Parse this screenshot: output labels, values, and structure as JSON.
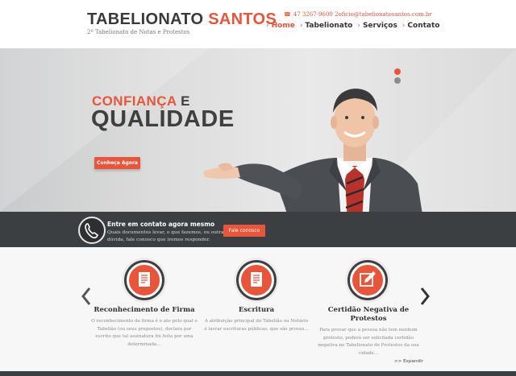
{
  "header": {
    "brand_main": "TABELIONATO",
    "brand_accent": "SANTOS",
    "brand_subtitle": "2º Tabelionato de Notas e Protestos",
    "contact": "47 3267-9600  2oficio@tabelionatosantos.com.br",
    "nav": [
      {
        "label": "Home",
        "active": true
      },
      {
        "label": "Tabelionato",
        "active": false
      },
      {
        "label": "Serviços",
        "active": false
      },
      {
        "label": "Contato",
        "active": false
      }
    ]
  },
  "hero": {
    "title_accent": "CONFIANÇA",
    "title_connector": "E",
    "title_main": "QUALIDADE",
    "cta_label": "Conheça Agora",
    "slides": 2,
    "active_slide": 1
  },
  "contact_strip": {
    "title": "Entre em contato agora mesmo",
    "text": "Quais documentos levar, o que fazemos, ou outra dúvida, fale conosco que iremos responder.",
    "button_label": "Fale conosco"
  },
  "services": [
    {
      "title": "Reconhecimento de Firma",
      "description": "O reconhecimento de firma é o ato pelo qual o Tabelião (ou seus prepostos), declara por escrito que tal assinatura foi feita por uma determinada...",
      "icon": "document-icon"
    },
    {
      "title": "Escritura",
      "description": "A atribuição principal do Tabelião ou Notário é lavrar escrituras públicas, que são provas...",
      "icon": "document-icon"
    },
    {
      "title": "Certidão Negativa de Protestos",
      "description": "Para provar que a pessoa não tem nenhum protesto, poderá ser solicitada certidão negativa no Tabelionato de Protestos da sua cidade...",
      "icon": "edit-icon"
    }
  ],
  "expand_label": ">> Expandir",
  "colors": {
    "accent": "#e8553a",
    "dark": "#3c3f41",
    "text": "#3f3f3f"
  }
}
